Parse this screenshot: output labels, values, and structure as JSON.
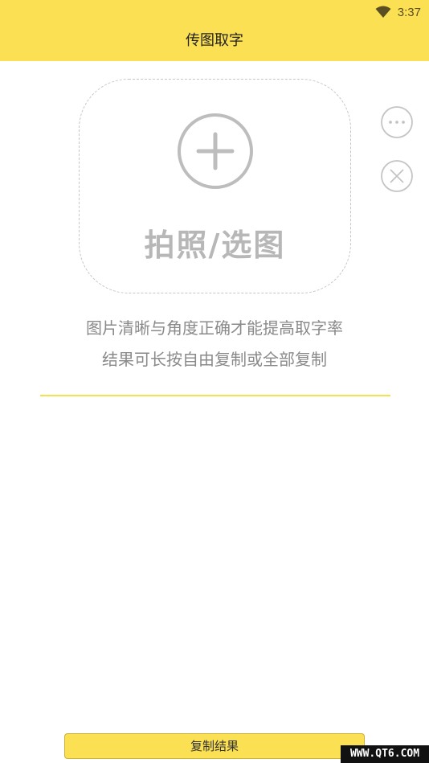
{
  "status_bar": {
    "time": "3:37",
    "wifi_icon": "wifi-icon"
  },
  "header": {
    "title": "传图取字"
  },
  "upload": {
    "label": "拍照/选图",
    "icon": "plus-circle-icon"
  },
  "side_actions": {
    "more_icon": "more-horizontal-icon",
    "close_icon": "close-circle-icon"
  },
  "tips": {
    "line1": "图片清晰与角度正确才能提高取字率",
    "line2": "结果可长按自由复制或全部复制"
  },
  "result": {
    "value": ""
  },
  "footer": {
    "copy_label": "复制结果"
  },
  "watermark": {
    "text": "WWW.QT6.COM"
  },
  "colors": {
    "accent": "#fbe054",
    "divider": "#f3e14f",
    "icon_gray": "#bdbdbd",
    "tip_gray": "#8a8a8a"
  }
}
